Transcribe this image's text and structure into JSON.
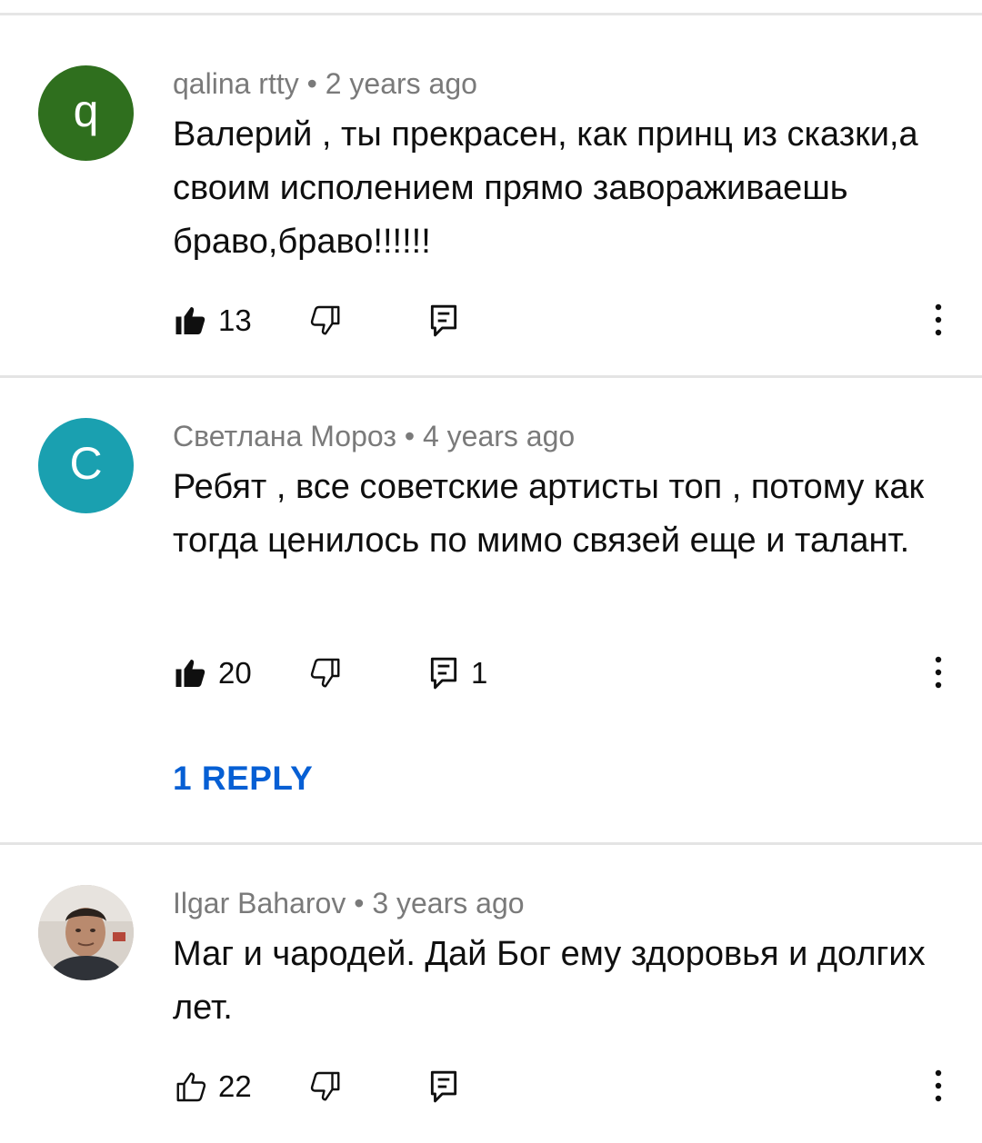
{
  "comments": [
    {
      "author": "qalina rtty",
      "separator": "•",
      "time": "2 years ago",
      "avatar_letter": "q",
      "avatar_color": "#2f6f1e",
      "text": "Валерий , ты прекрасен, как принц из сказки,а своим исполением прямо завораживаешь браво,браво!!!!!!",
      "likes": "13",
      "replies": "",
      "liked": true
    },
    {
      "author": "Светлана Мороз",
      "separator": "•",
      "time": "4 years ago",
      "avatar_letter": "С",
      "avatar_color": "#1aa0b0",
      "text": "Ребят , все советские артисты топ , потому как тогда ценилось по мимо связей еще и талант.",
      "likes": "20",
      "replies": "1",
      "reply_link": "1 REPLY",
      "liked": true
    },
    {
      "author": "Ilgar Baharov",
      "separator": "•",
      "time": "3 years ago",
      "avatar_letter": "",
      "text": "Маг и чародей. Дай Бог ему здоровья и долгих лет.",
      "likes": "22",
      "replies": "",
      "liked": false
    }
  ],
  "colors": {
    "link_blue": "#065fd4",
    "meta_gray": "#7a7a7a"
  }
}
